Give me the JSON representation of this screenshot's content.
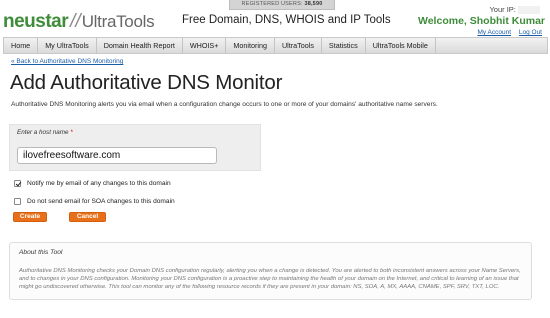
{
  "header": {
    "registered_label": "REGISTERED USERS:",
    "registered_count": "38,590",
    "logo_brand": "neustar",
    "logo_separator": "//",
    "logo_product": "UltraTools",
    "tagline": "Free Domain, DNS, WHOIS and IP Tools",
    "ip_label": "Your IP:",
    "welcome": "Welcome, Shobhit Kumar",
    "my_account": "My Account",
    "log_out": "Log Out"
  },
  "nav": {
    "items": [
      {
        "label": "Home"
      },
      {
        "label": "My UltraTools"
      },
      {
        "label": "Domain Health Report"
      },
      {
        "label": "WHOIS+"
      },
      {
        "label": "Monitoring"
      },
      {
        "label": "UltraTools"
      },
      {
        "label": "Statistics"
      },
      {
        "label": "UltraTools Mobile"
      }
    ]
  },
  "main": {
    "back_link": "« Back to Authoritative DNS Monitoring",
    "title": "Add Authoritative DNS Monitor",
    "description": "Authoritative DNS Monitoring alerts you via email when a configuration change occurs to one or more of your domains' authoritative name servers.",
    "form": {
      "host_label": "Enter a host name",
      "host_required_mark": "*",
      "host_value": "ilovefreesoftware.com",
      "notify_label": "Notify me by email of any changes to this domain",
      "notify_checked": true,
      "soa_label": "Do not send email for SOA changes to this domain",
      "soa_checked": false,
      "create_label": "Create",
      "cancel_label": "Cancel"
    },
    "about": {
      "title": "About this Tool",
      "body": "Authoritative DNS Monitoring checks your Domain DNS configuration regularly, alerting you when a change is detected. You are alerted to both inconsistent answers across your Name Servers, and to changes in your DNS configuration. Monitoring your DNS configuration is a proactive step to maintaining the health of your domain on the Internet, and critical to learning of an issue that might go undiscovered otherwise. This tool can monitor any of the following resource records if they are present in your domain: NS, SOA, A, MX, AAAA, CNAME, SPF, SRV, TXT, LOC."
    }
  },
  "colors": {
    "brand_green": "#3f8c3a",
    "link_blue": "#1a5ca8",
    "button_orange": "#e8701a"
  }
}
